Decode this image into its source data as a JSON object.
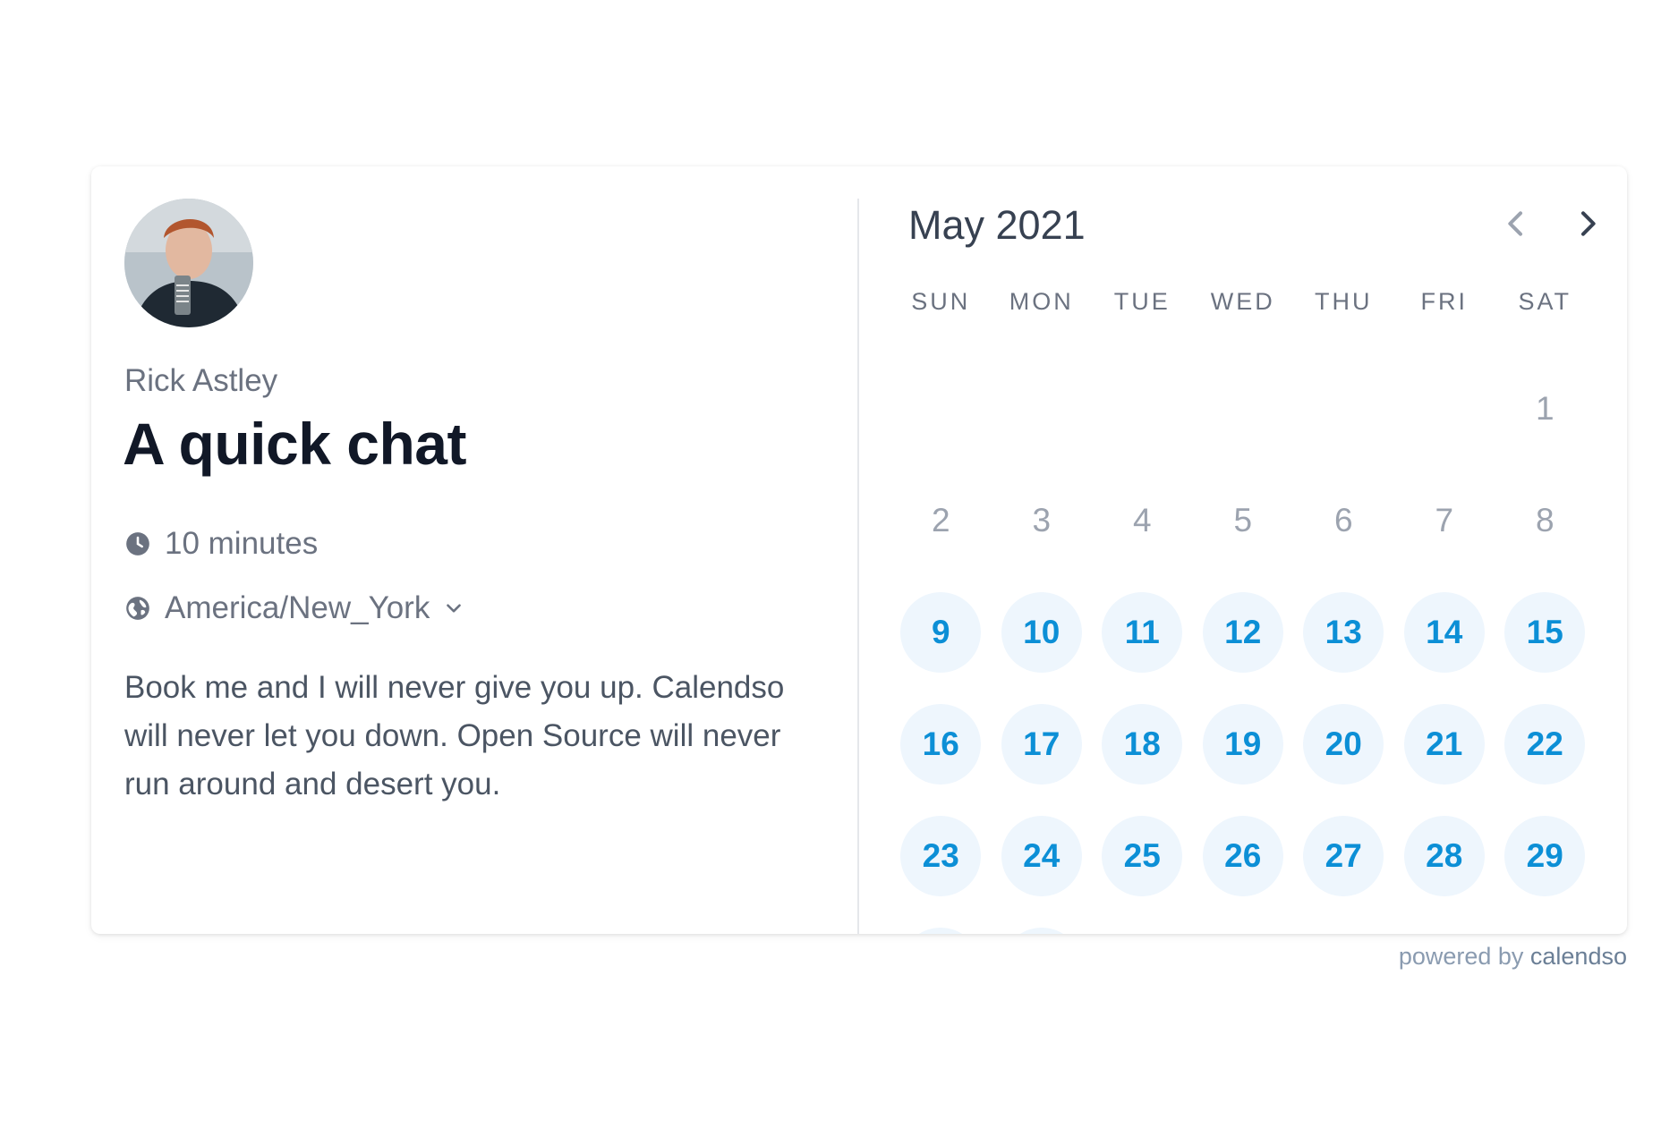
{
  "host": {
    "name": "Rick Astley"
  },
  "event": {
    "title": "A quick chat",
    "duration": "10 minutes",
    "timezone": "America/New_York",
    "description": "Book me and I will never give you up. Calendso will never let you down. Open Source will never run around and desert you."
  },
  "calendar": {
    "month_label": "May 2021",
    "weekdays": [
      "SUN",
      "MON",
      "TUE",
      "WED",
      "THU",
      "FRI",
      "SAT"
    ],
    "leading_blanks": 6,
    "days": [
      {
        "n": "1",
        "available": false
      },
      {
        "n": "2",
        "available": false
      },
      {
        "n": "3",
        "available": false
      },
      {
        "n": "4",
        "available": false
      },
      {
        "n": "5",
        "available": false
      },
      {
        "n": "6",
        "available": false
      },
      {
        "n": "7",
        "available": false
      },
      {
        "n": "8",
        "available": false
      },
      {
        "n": "9",
        "available": true
      },
      {
        "n": "10",
        "available": true
      },
      {
        "n": "11",
        "available": true
      },
      {
        "n": "12",
        "available": true
      },
      {
        "n": "13",
        "available": true
      },
      {
        "n": "14",
        "available": true
      },
      {
        "n": "15",
        "available": true
      },
      {
        "n": "16",
        "available": true
      },
      {
        "n": "17",
        "available": true
      },
      {
        "n": "18",
        "available": true
      },
      {
        "n": "19",
        "available": true
      },
      {
        "n": "20",
        "available": true
      },
      {
        "n": "21",
        "available": true
      },
      {
        "n": "22",
        "available": true
      },
      {
        "n": "23",
        "available": true
      },
      {
        "n": "24",
        "available": true
      },
      {
        "n": "25",
        "available": true
      },
      {
        "n": "26",
        "available": true
      },
      {
        "n": "27",
        "available": true
      },
      {
        "n": "28",
        "available": true
      },
      {
        "n": "29",
        "available": true
      },
      {
        "n": "",
        "available": true
      },
      {
        "n": "",
        "available": true
      }
    ]
  },
  "footer": {
    "powered_prefix": "powered by ",
    "brand": "calendso"
  },
  "icons": {
    "clock": "clock-icon",
    "globe": "globe-icon",
    "chevron_down": "chevron-down-icon",
    "prev": "chevron-left-icon",
    "next": "chevron-right-icon"
  },
  "colors": {
    "accent": "#0c8fd6",
    "available_bg": "#eef6fd",
    "muted_text": "#6b7280",
    "title_text": "#111827"
  }
}
